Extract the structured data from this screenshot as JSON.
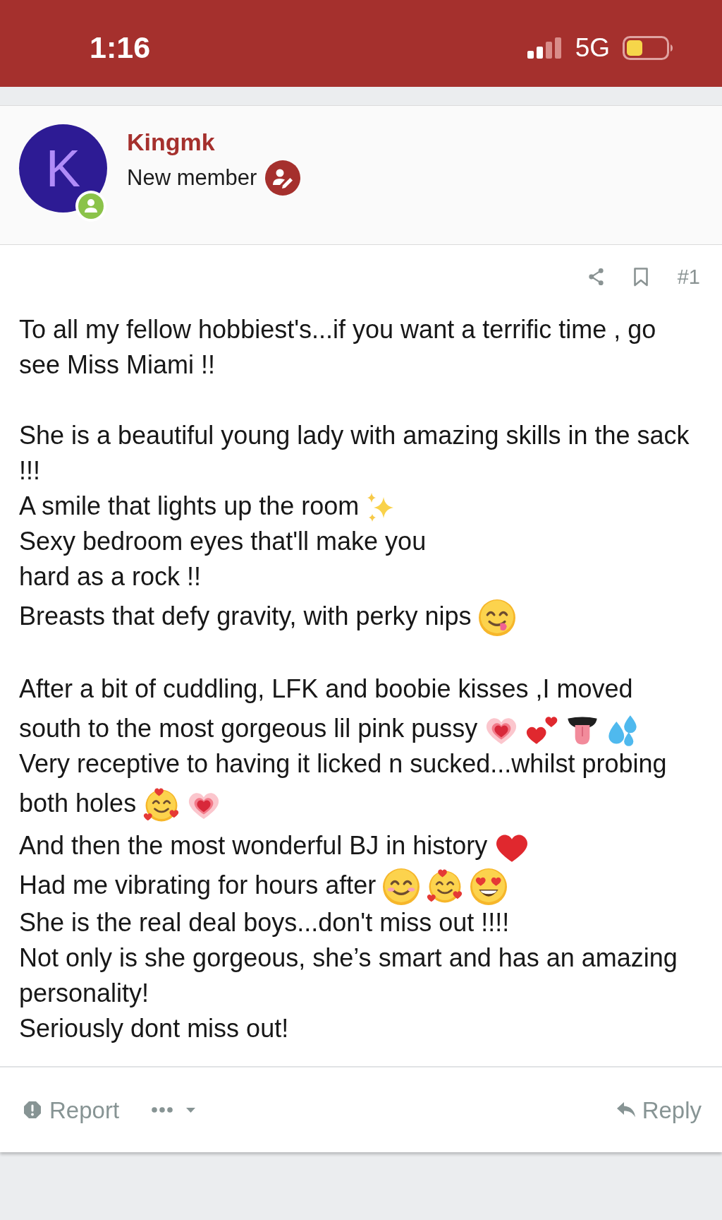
{
  "status_bar": {
    "time": "1:16",
    "network": "5G"
  },
  "author": {
    "initial": "K",
    "name": "Kingmk",
    "title": "New member",
    "online": true
  },
  "post": {
    "number": "#1",
    "paragraphs": [
      [
        {
          "text": "To all my fellow hobbiest's...if you want a terrific time , go see Miss Miami !!"
        }
      ],
      [
        {
          "text": "She is a beautiful young lady with amazing skills in the sack !!!"
        },
        {
          "text": "A smile that lights up the room",
          "icons": [
            {
              "kind": "sparkles"
            }
          ]
        },
        {
          "text": "Sexy bedroom eyes that'll make you"
        },
        {
          "text": "hard as a rock !!"
        },
        {
          "text": "Breasts that defy gravity, with perky nips",
          "icons": [
            {
              "kind": "savoring-face"
            }
          ]
        }
      ],
      [
        {
          "text": "After a bit of cuddling, LFK and boobie kisses ,I moved"
        },
        {
          "text": "south to the most gorgeous lil pink pussy",
          "icons": [
            {
              "kind": "growing-heart"
            },
            {
              "kind": "two-hearts"
            },
            {
              "kind": "tongue"
            },
            {
              "kind": "droplets"
            }
          ]
        },
        {
          "text": "Very receptive to having it licked n sucked...whilst probing"
        },
        {
          "text": "both holes",
          "icons": [
            {
              "kind": "hearts-face"
            },
            {
              "kind": "growing-heart"
            }
          ]
        },
        {
          "text": "And then the most wonderful BJ in history",
          "icons": [
            {
              "kind": "red-heart"
            }
          ]
        },
        {
          "text": "Had me vibrating for hours after",
          "icons": [
            {
              "kind": "smiling-face"
            },
            {
              "kind": "hearts-face"
            },
            {
              "kind": "heart-eyes-face"
            }
          ]
        },
        {
          "text": "She is the real deal boys...don't miss out !!!!"
        },
        {
          "text": "Not only is she gorgeous, she’s smart and has an amazing personality!"
        },
        {
          "text": "Seriously dont miss out!"
        }
      ]
    ]
  },
  "footer": {
    "report": "Report",
    "reply": "Reply"
  }
}
